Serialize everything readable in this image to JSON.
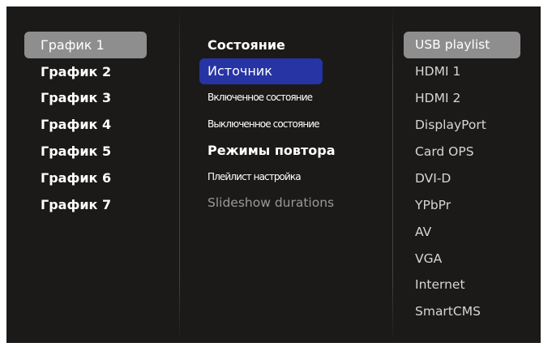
{
  "schedules": {
    "items": [
      {
        "label": "График 1",
        "selected": true
      },
      {
        "label": "График 2"
      },
      {
        "label": "График 3"
      },
      {
        "label": "График 4"
      },
      {
        "label": "График 5"
      },
      {
        "label": "График 6"
      },
      {
        "label": "График 7"
      }
    ]
  },
  "settings": {
    "items": [
      {
        "label": "Состояние"
      },
      {
        "label": "Источник",
        "focused": true
      },
      {
        "label": "Включенное состояние"
      },
      {
        "label": "Выключенное состояние"
      },
      {
        "label": "Режимы повтора"
      },
      {
        "label": "Плейлист настройка"
      },
      {
        "label": "Slideshow durations"
      }
    ]
  },
  "sources": {
    "items": [
      {
        "label": "USB playlist",
        "selected": true
      },
      {
        "label": "HDMI 1"
      },
      {
        "label": "HDMI 2"
      },
      {
        "label": "DisplayPort"
      },
      {
        "label": "Card OPS"
      },
      {
        "label": "DVI-D"
      },
      {
        "label": "YPbPr"
      },
      {
        "label": "AV"
      },
      {
        "label": "VGA"
      },
      {
        "label": "Internet"
      },
      {
        "label": "SmartCMS"
      }
    ]
  },
  "colors": {
    "background": "#1c1a19",
    "selected_gray": "#8e8e8e",
    "focus_blue": "#2634a4",
    "text": "#ffffff",
    "dim_text": "#9a9898"
  }
}
